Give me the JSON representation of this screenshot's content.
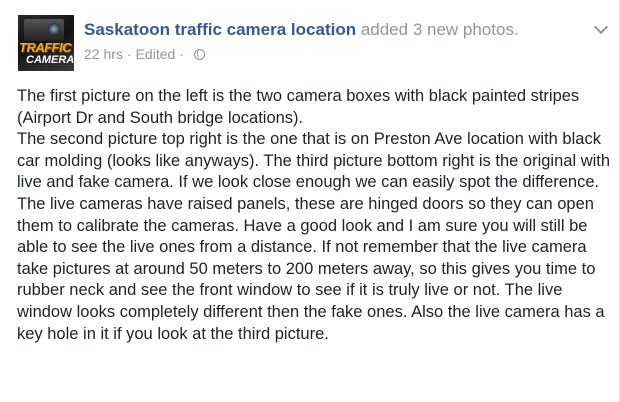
{
  "post": {
    "avatar": {
      "line1": "TRAFFIC",
      "line2": "CAMERA"
    },
    "author_name": "Saskatoon traffic camera location",
    "action": " added 3 new photos.",
    "time": "22 hrs",
    "separator": "·",
    "edited": "Edited",
    "audience_icon": "globe-icon",
    "options_icon": "chevron-down-icon",
    "paragraphs": [
      "The first picture on the left is the two camera boxes with black painted stripes (Airport Dr and South bridge locations).",
      "The second picture top right is the one that is on Preston Ave location with black car molding (looks like anyways). The third picture bottom right is the original with live and fake camera. If we look close enough we can easily spot the difference. The live cameras have raised panels, these are hinged doors so they can open them to calibrate the cameras. Have a good look and I am sure you will still be able to see the live ones from a distance. If not remember that the live camera take pictures at around 50 meters to 200 meters away, so this gives you time to rubber neck and see the front window to see if it is truly live or not. The live window looks completely different then the fake ones. Also the live camera has a key hole in it if you look at the third picture."
    ]
  }
}
